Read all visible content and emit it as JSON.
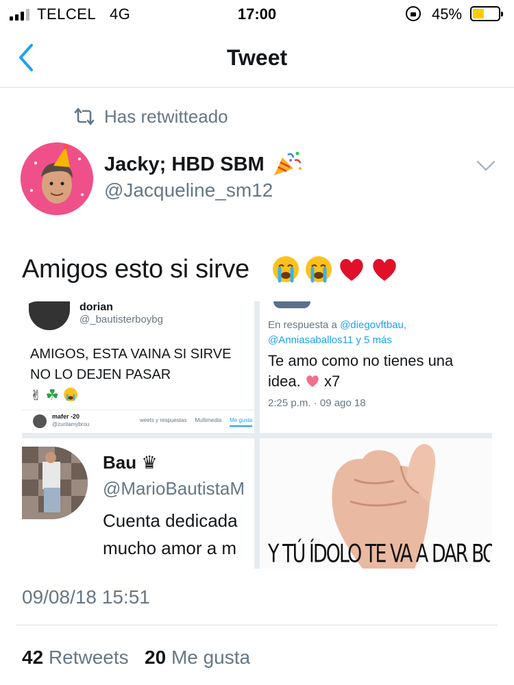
{
  "status_bar": {
    "carrier": "TELCEL",
    "network": "4G",
    "time": "17:00",
    "battery_percent": "45%",
    "battery_level": 0.45,
    "battery_color": "#ffcc00",
    "icons": [
      "signal-icon",
      "orientation-lock-icon",
      "battery-icon"
    ]
  },
  "nav": {
    "title": "Tweet",
    "back_icon": "chevron-left-icon",
    "accent_color": "#1da1f2"
  },
  "tweet": {
    "retweet_label": "Has retwitteado",
    "author_name": "Jacky; HBD SBM",
    "author_handle": "@Jacqueline_sm12",
    "text": "Amigos esto si sirve",
    "text_emojis": [
      "loudly-crying-face-icon",
      "loudly-crying-face-icon",
      "red-heart-icon",
      "red-heart-icon"
    ],
    "timestamp": "09/08/18 15:51",
    "retweets_count": "42",
    "retweets_label": "Retweets",
    "likes_count": "20",
    "likes_label": "Me gusta"
  },
  "media": {
    "image1": {
      "name": "dorian",
      "handle": "@_bautisterboybg",
      "body": "AMIGOS, ESTA VAINA SI SIRVE NO LO DEJEN PASAR",
      "mini_name": "mafer -20",
      "mini_handle": "@zuritamybrou",
      "mini_tabs": [
        "weets y respuestas",
        "Multimedia",
        "Me gusta"
      ]
    },
    "image2": {
      "reply_prefix": "En respuesta a",
      "reply_user1": "@diegovftbau,",
      "reply_user2": "@Anniasaballos11 y 5 más",
      "body": "Te amo como no tienes una idea.",
      "body_suffix": "x7",
      "time": "2:25 p.m. · 09 ago 18"
    },
    "image3": {
      "name": "Bau",
      "handle": "@MarioBautistaM",
      "bio_line1": "Cuenta dedicada",
      "bio_line2": "mucho amor a m"
    },
    "image4": {
      "caption": "Y TÚ ÍDOLO TE VA A DAR BOLA"
    }
  }
}
